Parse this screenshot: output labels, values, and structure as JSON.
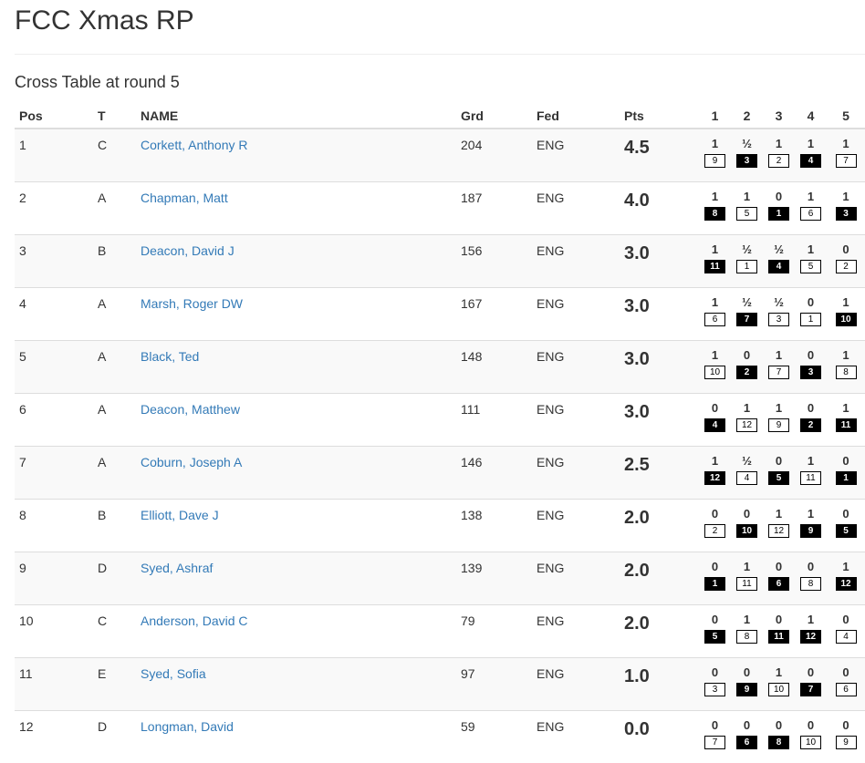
{
  "page": {
    "title": "FCC Xmas RP",
    "subtitle": "Cross Table at round 5"
  },
  "table": {
    "headers": {
      "pos": "Pos",
      "team": "T",
      "name": "NAME",
      "grade": "Grd",
      "fed": "Fed",
      "pts": "Pts",
      "rounds": [
        "1",
        "2",
        "3",
        "4",
        "5"
      ]
    },
    "rows": [
      {
        "pos": "1",
        "team": "C",
        "name": "Corkett, Anthony R",
        "grade": "204",
        "fed": "ENG",
        "pts": "4.5",
        "rounds": [
          {
            "score": "1",
            "opp": "9",
            "color": "white"
          },
          {
            "score": "½",
            "opp": "3",
            "color": "black"
          },
          {
            "score": "1",
            "opp": "2",
            "color": "white"
          },
          {
            "score": "1",
            "opp": "4",
            "color": "black"
          },
          {
            "score": "1",
            "opp": "7",
            "color": "white"
          }
        ]
      },
      {
        "pos": "2",
        "team": "A",
        "name": "Chapman, Matt",
        "grade": "187",
        "fed": "ENG",
        "pts": "4.0",
        "rounds": [
          {
            "score": "1",
            "opp": "8",
            "color": "black"
          },
          {
            "score": "1",
            "opp": "5",
            "color": "white"
          },
          {
            "score": "0",
            "opp": "1",
            "color": "black"
          },
          {
            "score": "1",
            "opp": "6",
            "color": "white"
          },
          {
            "score": "1",
            "opp": "3",
            "color": "black"
          }
        ]
      },
      {
        "pos": "3",
        "team": "B",
        "name": "Deacon, David J",
        "grade": "156",
        "fed": "ENG",
        "pts": "3.0",
        "rounds": [
          {
            "score": "1",
            "opp": "11",
            "color": "black"
          },
          {
            "score": "½",
            "opp": "1",
            "color": "white"
          },
          {
            "score": "½",
            "opp": "4",
            "color": "black"
          },
          {
            "score": "1",
            "opp": "5",
            "color": "white"
          },
          {
            "score": "0",
            "opp": "2",
            "color": "white"
          }
        ]
      },
      {
        "pos": "4",
        "team": "A",
        "name": "Marsh, Roger DW",
        "grade": "167",
        "fed": "ENG",
        "pts": "3.0",
        "rounds": [
          {
            "score": "1",
            "opp": "6",
            "color": "white"
          },
          {
            "score": "½",
            "opp": "7",
            "color": "black"
          },
          {
            "score": "½",
            "opp": "3",
            "color": "white"
          },
          {
            "score": "0",
            "opp": "1",
            "color": "white"
          },
          {
            "score": "1",
            "opp": "10",
            "color": "black"
          }
        ]
      },
      {
        "pos": "5",
        "team": "A",
        "name": "Black, Ted",
        "grade": "148",
        "fed": "ENG",
        "pts": "3.0",
        "rounds": [
          {
            "score": "1",
            "opp": "10",
            "color": "white"
          },
          {
            "score": "0",
            "opp": "2",
            "color": "black"
          },
          {
            "score": "1",
            "opp": "7",
            "color": "white"
          },
          {
            "score": "0",
            "opp": "3",
            "color": "black"
          },
          {
            "score": "1",
            "opp": "8",
            "color": "white"
          }
        ]
      },
      {
        "pos": "6",
        "team": "A",
        "name": "Deacon, Matthew",
        "grade": "111",
        "fed": "ENG",
        "pts": "3.0",
        "rounds": [
          {
            "score": "0",
            "opp": "4",
            "color": "black"
          },
          {
            "score": "1",
            "opp": "12",
            "color": "white"
          },
          {
            "score": "1",
            "opp": "9",
            "color": "white"
          },
          {
            "score": "0",
            "opp": "2",
            "color": "black"
          },
          {
            "score": "1",
            "opp": "11",
            "color": "black"
          }
        ]
      },
      {
        "pos": "7",
        "team": "A",
        "name": "Coburn, Joseph A",
        "grade": "146",
        "fed": "ENG",
        "pts": "2.5",
        "rounds": [
          {
            "score": "1",
            "opp": "12",
            "color": "black"
          },
          {
            "score": "½",
            "opp": "4",
            "color": "white"
          },
          {
            "score": "0",
            "opp": "5",
            "color": "black"
          },
          {
            "score": "1",
            "opp": "11",
            "color": "white"
          },
          {
            "score": "0",
            "opp": "1",
            "color": "black"
          }
        ]
      },
      {
        "pos": "8",
        "team": "B",
        "name": "Elliott, Dave J",
        "grade": "138",
        "fed": "ENG",
        "pts": "2.0",
        "rounds": [
          {
            "score": "0",
            "opp": "2",
            "color": "white"
          },
          {
            "score": "0",
            "opp": "10",
            "color": "black"
          },
          {
            "score": "1",
            "opp": "12",
            "color": "white"
          },
          {
            "score": "1",
            "opp": "9",
            "color": "black"
          },
          {
            "score": "0",
            "opp": "5",
            "color": "black"
          }
        ]
      },
      {
        "pos": "9",
        "team": "D",
        "name": "Syed, Ashraf",
        "grade": "139",
        "fed": "ENG",
        "pts": "2.0",
        "rounds": [
          {
            "score": "0",
            "opp": "1",
            "color": "black"
          },
          {
            "score": "1",
            "opp": "11",
            "color": "white"
          },
          {
            "score": "0",
            "opp": "6",
            "color": "black"
          },
          {
            "score": "0",
            "opp": "8",
            "color": "white"
          },
          {
            "score": "1",
            "opp": "12",
            "color": "black"
          }
        ]
      },
      {
        "pos": "10",
        "team": "C",
        "name": "Anderson, David C",
        "grade": "79",
        "fed": "ENG",
        "pts": "2.0",
        "rounds": [
          {
            "score": "0",
            "opp": "5",
            "color": "black"
          },
          {
            "score": "1",
            "opp": "8",
            "color": "white"
          },
          {
            "score": "0",
            "opp": "11",
            "color": "black"
          },
          {
            "score": "1",
            "opp": "12",
            "color": "black"
          },
          {
            "score": "0",
            "opp": "4",
            "color": "white"
          }
        ]
      },
      {
        "pos": "11",
        "team": "E",
        "name": "Syed, Sofia",
        "grade": "97",
        "fed": "ENG",
        "pts": "1.0",
        "rounds": [
          {
            "score": "0",
            "opp": "3",
            "color": "white"
          },
          {
            "score": "0",
            "opp": "9",
            "color": "black"
          },
          {
            "score": "1",
            "opp": "10",
            "color": "white"
          },
          {
            "score": "0",
            "opp": "7",
            "color": "black"
          },
          {
            "score": "0",
            "opp": "6",
            "color": "white"
          }
        ]
      },
      {
        "pos": "12",
        "team": "D",
        "name": "Longman, David",
        "grade": "59",
        "fed": "ENG",
        "pts": "0.0",
        "rounds": [
          {
            "score": "0",
            "opp": "7",
            "color": "white"
          },
          {
            "score": "0",
            "opp": "6",
            "color": "black"
          },
          {
            "score": "0",
            "opp": "8",
            "color": "black"
          },
          {
            "score": "0",
            "opp": "10",
            "color": "white"
          },
          {
            "score": "0",
            "opp": "9",
            "color": "white"
          }
        ]
      }
    ]
  },
  "colors": {
    "link": "#337ab7",
    "stripe": "#f9f9f9",
    "border": "#dddddd"
  }
}
